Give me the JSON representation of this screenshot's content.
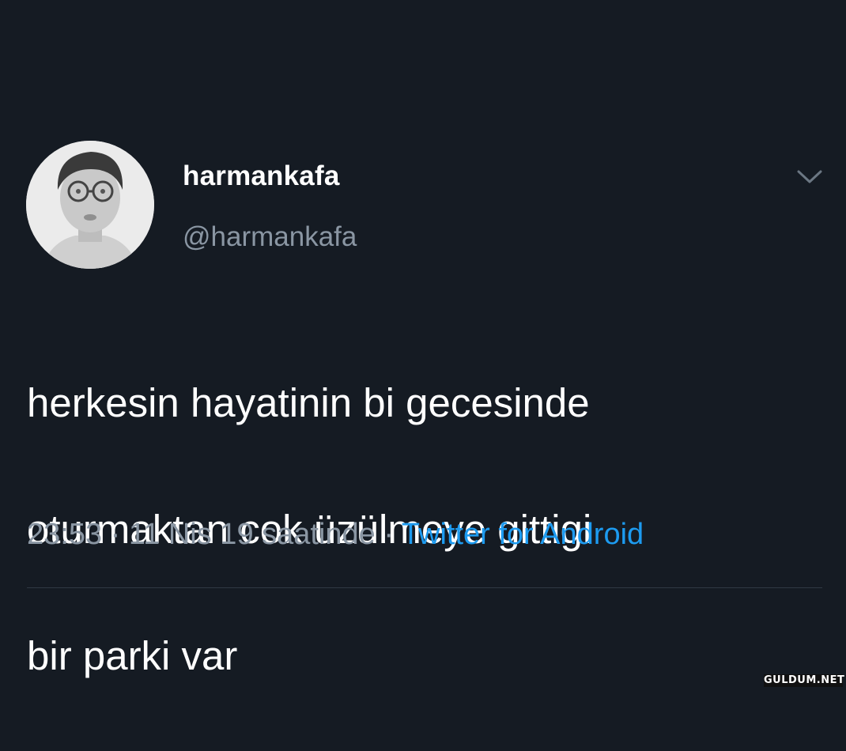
{
  "tweet": {
    "display_name": "harmankafa",
    "handle": "@harmankafa",
    "text_lines": [
      "herkesin hayatinin bi gecesinde",
      "oturmaktan cok üzülmeye gittigi",
      "bir parki var"
    ],
    "timestamp": "23:53 · 11 Nis 19 saatinde",
    "separator": " · ",
    "source": "Twitter for Android"
  },
  "icons": {
    "menu": "chevron-down-icon",
    "avatar": "avatar"
  },
  "colors": {
    "background": "#151b23",
    "text": "#ffffff",
    "secondary_text": "#8a96a3",
    "link": "#1d9bf0"
  },
  "watermark": "GULDUM.NET"
}
